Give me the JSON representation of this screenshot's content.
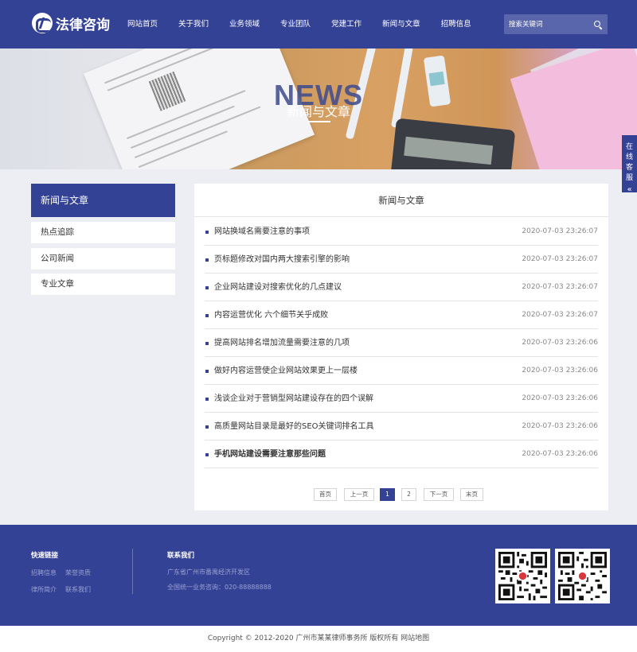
{
  "header": {
    "logo_text": "法律咨询",
    "nav": [
      "网站首页",
      "关于我们",
      "业务领域",
      "专业团队",
      "党建工作",
      "新闻与文章",
      "招聘信息"
    ],
    "search_placeholder": "搜索关键词"
  },
  "banner": {
    "title_en": "NEWS",
    "title_cn": "新闻与文章"
  },
  "service": {
    "label_chars": [
      "在",
      "线",
      "客",
      "服"
    ],
    "collapse_glyph": "«"
  },
  "sidebar": {
    "title": "新闻与文章",
    "items": [
      "热点追踪",
      "公司新闻",
      "专业文章"
    ]
  },
  "main": {
    "title": "新闻与文章",
    "articles": [
      {
        "title": "网站换域名需要注意的事项",
        "date": "2020-07-03 23:26:07"
      },
      {
        "title": "页标题修改对国内两大搜索引擎的影响",
        "date": "2020-07-03 23:26:07"
      },
      {
        "title": "企业网站建设对搜索优化的几点建议",
        "date": "2020-07-03 23:26:07"
      },
      {
        "title": "内容运营优化 六个细节关乎成败",
        "date": "2020-07-03 23:26:07"
      },
      {
        "title": "提高网站排名增加流量需要注意的几项",
        "date": "2020-07-03 23:26:06"
      },
      {
        "title": "做好内容运营使企业网站效果更上一层楼",
        "date": "2020-07-03 23:26:06"
      },
      {
        "title": "浅谈企业对于营销型网站建设存在的四个误解",
        "date": "2020-07-03 23:26:06"
      },
      {
        "title": "高质量网站目录是最好的SEO关键词排名工具",
        "date": "2020-07-03 23:26:06"
      },
      {
        "title": "手机网站建设需要注意那些问题",
        "date": "2020-07-03 23:26:06"
      }
    ],
    "pagination": {
      "first": "首页",
      "prev": "上一页",
      "pages": [
        "1",
        "2"
      ],
      "current": "1",
      "next": "下一页",
      "last": "末页"
    }
  },
  "footer": {
    "quick_links_title": "快速链接",
    "quick_links": [
      "招聘信息",
      "荣誉资质",
      "律所简介",
      "联系我们"
    ],
    "contact_title": "联系我们",
    "address": "广东省广州市番禺经济开发区",
    "phone": "全国统一业务咨询：020-88888888"
  },
  "copyright": "Copyright © 2012-2020 广州市某某律师事务所 版权所有 网站地图",
  "colors": {
    "brand": "#344296",
    "background": "#eceef4"
  }
}
